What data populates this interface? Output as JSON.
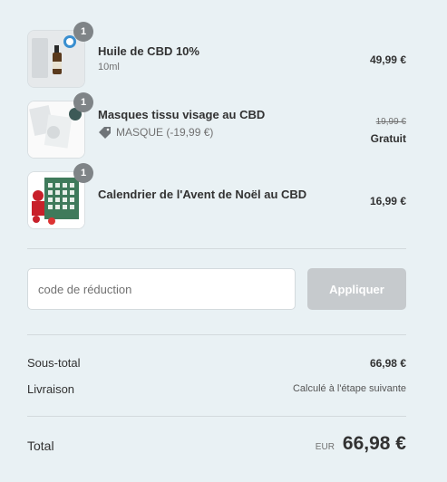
{
  "items": [
    {
      "quantity": "1",
      "name": "Huile de CBD 10%",
      "variant": "10ml",
      "price": "49,99 €",
      "image_icon": "cbd-oil-bottle-icon"
    },
    {
      "quantity": "1",
      "name": "Masques tissu visage au CBD",
      "discount_label": "MASQUE (-19,99 €)",
      "original_price": "19,99 €",
      "price": "Gratuit",
      "image_icon": "face-mask-pack-icon"
    },
    {
      "quantity": "1",
      "name": "Calendrier de l'Avent de Noël au CBD",
      "price": "16,99 €",
      "image_icon": "advent-calendar-icon"
    }
  ],
  "discount": {
    "placeholder": "code de réduction",
    "button_label": "Appliquer"
  },
  "summary": {
    "subtotal_label": "Sous-total",
    "subtotal_value": "66,98 €",
    "shipping_label": "Livraison",
    "shipping_value": "Calculé à l'étape suivante",
    "total_label": "Total",
    "total_currency": "EUR",
    "total_value": "66,98 €"
  },
  "colors": {
    "background": "#e9f1f4",
    "text": "#323232",
    "muted": "#717171",
    "button_disabled": "#c6cacd",
    "badge": "#7f8487"
  }
}
